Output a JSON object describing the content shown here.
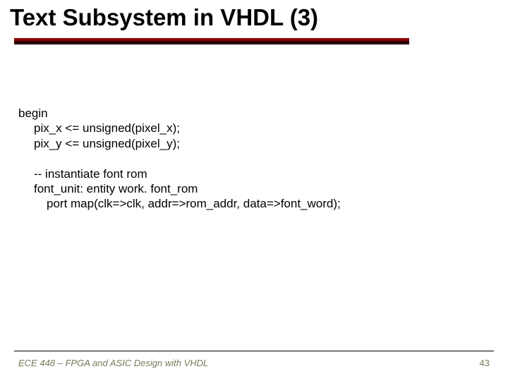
{
  "title": "Text Subsystem in VHDL (3)",
  "code": {
    "l1": "begin",
    "l2": "pix_x <= unsigned(pixel_x);",
    "l3": "pix_y <= unsigned(pixel_y);",
    "l4": "-- instantiate font rom",
    "l5": "font_unit: entity work. font_rom",
    "l6": "port map(clk=>clk, addr=>rom_addr, data=>font_word);"
  },
  "footer": {
    "left": "ECE 448 – FPGA and ASIC Design with VHDL",
    "page": "43"
  }
}
